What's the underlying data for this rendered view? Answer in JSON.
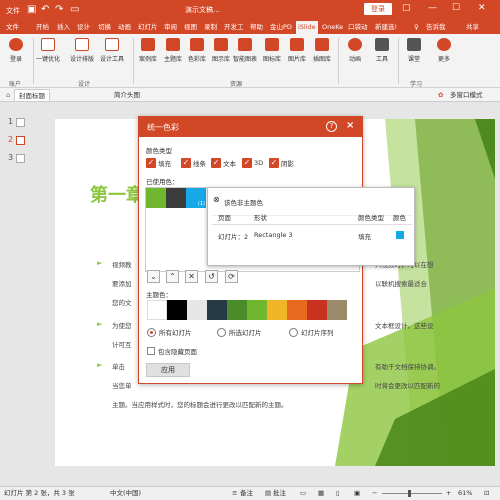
{
  "titlebar": {
    "doc_title": "演示文稿...",
    "login": "登录",
    "icons": [
      "save-icon",
      "undo-icon",
      "redo-icon",
      "slideshow-icon",
      "restore-icon",
      "minimize-icon",
      "maximize-icon",
      "close-icon"
    ]
  },
  "tabs": [
    "文件",
    "开始",
    "插入",
    "设计",
    "切换",
    "动画",
    "幻灯片",
    "审阅",
    "视图",
    "录制",
    "开发工",
    "帮助",
    "金山PD",
    "iSlide",
    "OneKe",
    "口袋动",
    "新建选!"
  ],
  "active_tab": "iSlide",
  "tell_me": "告诉我",
  "share": "共享",
  "ribbon": {
    "buttons": [
      "登录",
      "一键优化",
      "设计排版",
      "设计工具",
      "案例库",
      "主题库",
      "色彩库",
      "图示库",
      "智能图表",
      "图标库",
      "图片库",
      "插图库",
      "动画",
      "工具",
      "课堂",
      "更多"
    ],
    "groups": [
      "账户",
      "设计",
      "资源",
      "学习"
    ]
  },
  "doc_tabs": [
    "封面标题",
    "简介头图"
  ],
  "view_mode": "多窗口模式",
  "thumbnails": [
    "1",
    "2",
    "3"
  ],
  "slide": {
    "title": "第一章",
    "lines": [
      "视频教",
      "要添加",
      "您的文",
      "为使您",
      "计可互",
      "单击",
      "当您单",
      "主题。当应用样式时，您的标题会进行更改以匹配新的主题。"
    ],
    "right_lines": [
      "入视频时，可以在想",
      "以联机搜索最适合",
      "文本框设计，这些设",
      "有助于文档保持协调。",
      "时将会更改以匹配新的"
    ]
  },
  "dialog": {
    "title": "统一色彩",
    "help": "?",
    "close": "×",
    "color_type_label": "颜色类型",
    "checkboxes": [
      "填充",
      "线条",
      "文本",
      "3D",
      "阴影"
    ],
    "used_label": "已使用色：",
    "used_colors": [
      "#70b62e",
      "#3c3c3c",
      "#17a8e6"
    ],
    "used_colors_more": "(1)",
    "icon_buttons": [
      "chevron-down-icon",
      "chevron-up-icon",
      "close-icon",
      "undo-icon",
      "refresh-icon"
    ],
    "theme_label": "主题色：",
    "theme_colors": [
      "#ffffff",
      "#000000",
      "#e7e6e6",
      "#263a46",
      "#4b8c2a",
      "#70b62e",
      "#f2b52a",
      "#e86a1f",
      "#c8321f",
      "#9c8b6a"
    ],
    "radios": [
      "所有幻灯片",
      "所选幻灯片",
      "幻灯片序列"
    ],
    "hidden_checkbox": "包含隐藏页面",
    "apply": "应用"
  },
  "popup": {
    "title": "该色非主题色",
    "headers": [
      "页面",
      "形状",
      "颜色类型",
      "颜色"
    ],
    "row": {
      "page": "幻灯片：2",
      "shape": "Rectangle 3",
      "type": "填充",
      "color": "#17a8e6"
    }
  },
  "statusbar": {
    "slide_info": "幻灯片 第 2 张，共 3 张",
    "language": "中文(中国)",
    "notes": "备注",
    "comments": "批注",
    "zoom": "61%"
  }
}
